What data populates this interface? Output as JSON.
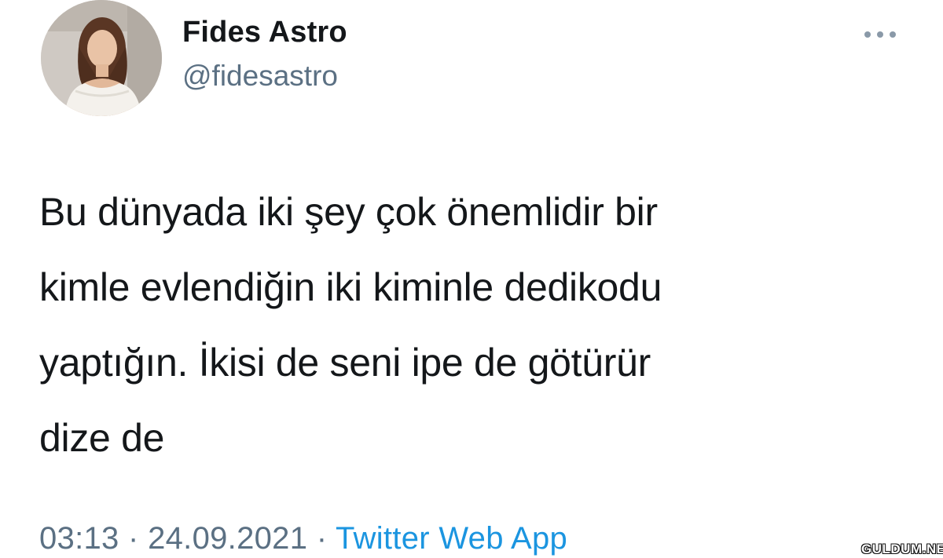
{
  "user": {
    "display_name": "Fides Astro",
    "handle": "@fidesastro",
    "avatar_icon": "profile-photo"
  },
  "more_icon": "more-horizontal-icon",
  "tweet": {
    "lines": [
      "Bu dünyada iki şey çok önemlidir bir",
      "kimle evlendiğin iki kiminle dedikodu",
      "yaptığın. İkisi de seni ipe de götürür",
      "dize de"
    ]
  },
  "meta": {
    "time": "03:13",
    "separator": "·",
    "date": "24.09.2021",
    "source": "Twitter Web App"
  },
  "watermark": "GULDUM.NET",
  "colors": {
    "text": "#14171a",
    "secondary": "#5b7083",
    "link": "#1b95e0",
    "background": "#ffffff"
  }
}
